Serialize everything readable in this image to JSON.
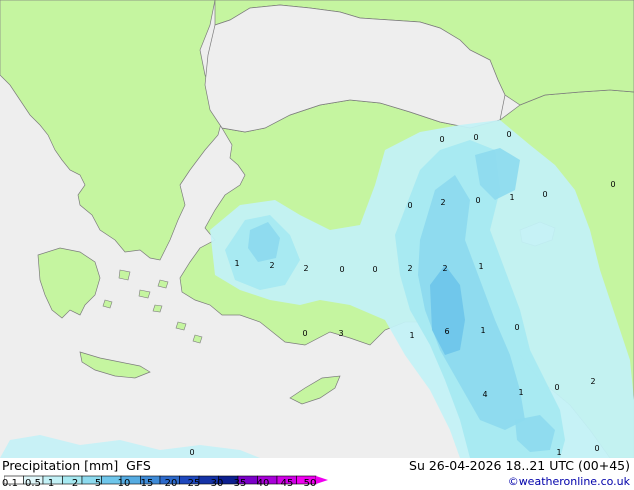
{
  "footer": {
    "title": "Precipitation [mm]  GFS",
    "timestamp": "Su 26-04-2026 18..21 UTC (00+45)",
    "credit": "©weatheronline.co.uk"
  },
  "legend": {
    "ticks": [
      "0.1",
      "0.5",
      "1",
      "2",
      "5",
      "10",
      "15",
      "20",
      "25",
      "30",
      "35",
      "40",
      "45",
      "50"
    ],
    "colors": [
      "#ffffff",
      "#e0f8fb",
      "#c3f1f6",
      "#a7e9f1",
      "#8ddaee",
      "#6fc6ea",
      "#55abe1",
      "#3f8bd7",
      "#2d6acb",
      "#1e48bd",
      "#1432a6",
      "#0c1f8f",
      "#7a00c8",
      "#a700d8",
      "#d000e6",
      "#f000f0"
    ]
  },
  "map_labels": [
    "0",
    "0",
    "0",
    "0",
    "2",
    "0",
    "1",
    "0",
    "0",
    "1",
    "2",
    "2",
    "0",
    "0",
    "2",
    "2",
    "1",
    "1",
    "6",
    "1",
    "0",
    "0",
    "3",
    "4",
    "1",
    "0",
    "2",
    "1",
    "0",
    "0"
  ],
  "colors": {
    "land": "#c5f5a0",
    "sea": "#eeeeee",
    "coast": "#7c7c7c"
  }
}
